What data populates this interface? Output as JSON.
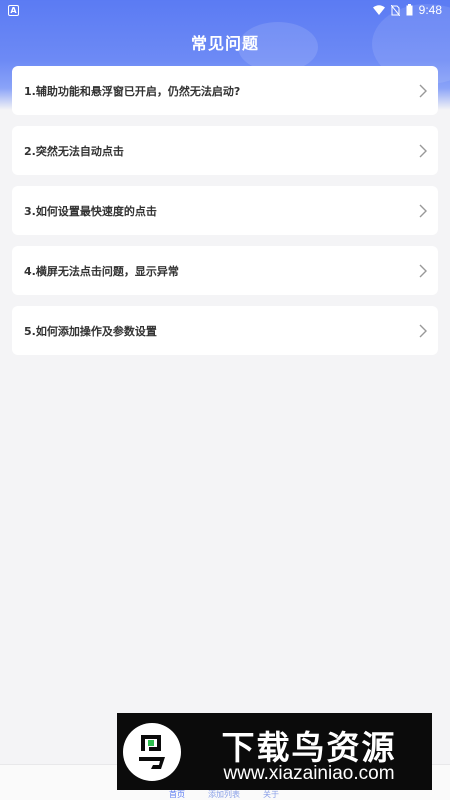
{
  "status_bar": {
    "left_badge": "A",
    "time": "9:48"
  },
  "header": {
    "title": "常见问题"
  },
  "faq": {
    "items": [
      {
        "label": "1.辅助功能和悬浮窗已开启，仍然无法启动?"
      },
      {
        "label": "2.突然无法自动点击"
      },
      {
        "label": "3.如何设置最快速度的点击"
      },
      {
        "label": "4.横屏无法点击问题，显示异常"
      },
      {
        "label": "5.如何添加操作及参数设置"
      }
    ]
  },
  "bottom_nav": {
    "tabs": [
      {
        "label": "首页"
      },
      {
        "label": "添加列表"
      },
      {
        "label": "关于"
      }
    ]
  },
  "watermark": {
    "title": "下载鸟资源",
    "url": "www.xiazainiao.com"
  },
  "colors": {
    "accent": "#5b7bf3",
    "background": "#f4f4f6",
    "card": "#ffffff",
    "text": "#333333"
  }
}
